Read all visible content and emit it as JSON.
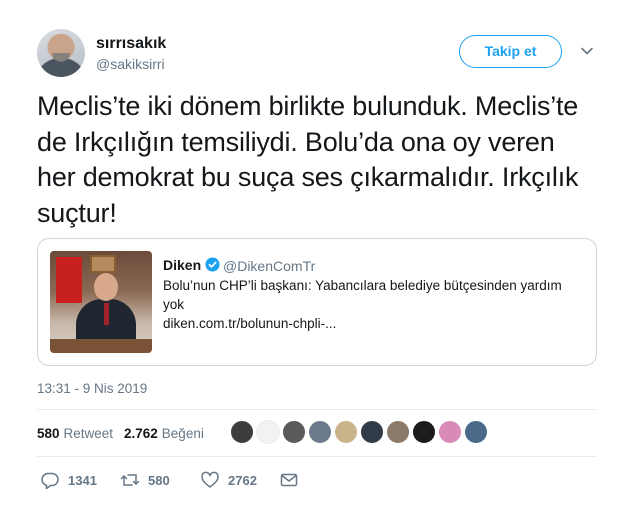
{
  "author": {
    "display_name": "sırrısakık",
    "handle": "@sakiksirri"
  },
  "follow_button_label": "Takip et",
  "tweet_text": "Meclis’te iki dönem birlikte bulunduk. Meclis’te de Irkçılığın temsiliydi. Bolu’da ona oy veren her demokrat bu suça ses çıkarmalıdır. Irkçılık suçtur!",
  "quoted": {
    "name": "Diken",
    "handle": "@DikenComTr",
    "text": "Bolu’nun CHP’li başkanı: Yabancılara belediye bütçesinden yardım yok",
    "link": "diken.com.tr/bolunun-chpli-..."
  },
  "timestamp": "13:31 - 9 Nis 2019",
  "stats": {
    "retweet_count": "580",
    "retweet_label": "Retweet",
    "like_count": "2.762",
    "like_label": "Beğeni"
  },
  "likers": [
    {
      "icon": "avatar-photo",
      "color": "#3d3d3d"
    },
    {
      "icon": "avatar-logo",
      "color": "#f2f2f2"
    },
    {
      "icon": "avatar-photo",
      "color": "#5a5a5a"
    },
    {
      "icon": "avatar-photo",
      "color": "#6b7a8c"
    },
    {
      "icon": "avatar-photo",
      "color": "#c9b48a"
    },
    {
      "icon": "avatar-photo",
      "color": "#2f3b47"
    },
    {
      "icon": "avatar-photo",
      "color": "#8b7a6a"
    },
    {
      "icon": "avatar-photo",
      "color": "#1c1c1c"
    },
    {
      "icon": "avatar-photo",
      "color": "#d98bb8"
    },
    {
      "icon": "avatar-photo",
      "color": "#4a6a8a"
    }
  ],
  "actions": {
    "reply_count": "1341",
    "retweet_count": "580",
    "like_count": "2762"
  },
  "colors": {
    "accent": "#1da1f2",
    "verified": "#1da1f2",
    "muted": "#657786",
    "divider": "#e6ecf0"
  }
}
